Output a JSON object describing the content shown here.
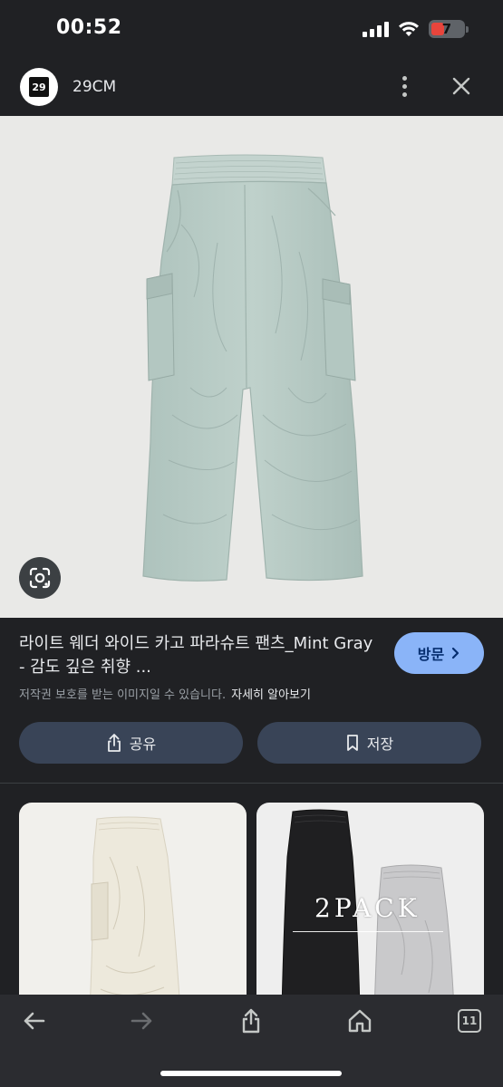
{
  "status": {
    "time": "00:52",
    "battery_level": "7"
  },
  "site": {
    "logo_text": "29",
    "name": "29CM"
  },
  "product": {
    "title": "라이트 웨더 와이드 카고 파라슈트 팬츠_Mint Gray - 감도 깊은 취향 ...",
    "visit_label": "방문",
    "copyright_notice": "저작권 보호를 받는 이미지일 수 있습니다.",
    "learn_more": "자세히 알아보기",
    "share_label": "공유",
    "save_label": "저장"
  },
  "related": {
    "items": [
      {
        "overlay_text": ""
      },
      {
        "overlay_text": "2PACK"
      }
    ]
  },
  "bottom_nav": {
    "tab_count": "11"
  },
  "colors": {
    "background": "#202124",
    "visit_button": "#8ab4f8",
    "action_button": "#394457",
    "hero_background": "#e9e9e7",
    "pants_mint": "#b8cbc5"
  }
}
